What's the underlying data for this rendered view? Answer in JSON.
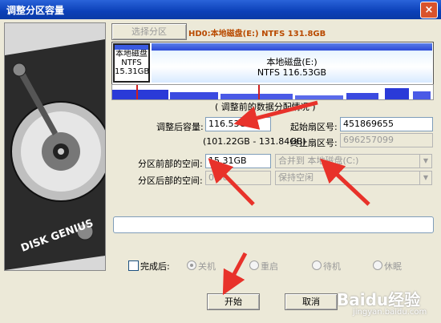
{
  "window": {
    "title": "调整分区容量",
    "close_label": "×"
  },
  "header": {
    "select_partition_label": "选择分区",
    "disk_info": "HD0:本地磁盘(E:) NTFS 131.8GB"
  },
  "disk_map": {
    "partition1": {
      "name": "本地磁盘",
      "fs": "NTFS",
      "size": "15.31GB"
    },
    "partition2": {
      "name": "本地磁盘(E:)",
      "fs": "NTFS",
      "size": "116.53GB"
    },
    "usage_caption": "( 调整前的数据分配情况 )"
  },
  "form": {
    "new_size_label": "调整后容量:",
    "new_size_value": "116.53GB",
    "range_text": "(101.22GB - 131.84GB)",
    "start_sector_label": "起始扇区号:",
    "start_sector_value": "451869655",
    "end_sector_label": "终止扇区号:",
    "end_sector_value": "696257099",
    "space_before_label": "分区前部的空间:",
    "space_before_value": "15.31GB",
    "space_before_action": "合并到 本地磁盘(C:)",
    "space_after_label": "分区后部的空间:",
    "space_after_value": "0.00",
    "space_after_action": "保持空闲"
  },
  "completion": {
    "label": "完成后:",
    "options": [
      "关机",
      "重启",
      "待机",
      "休眠"
    ]
  },
  "buttons": {
    "start": "开始",
    "cancel": "取消"
  },
  "watermark": {
    "brand": "Baidu经验",
    "url": "jingyan.baidu.com"
  },
  "side_image": {
    "text": "DISK GENIUS"
  }
}
